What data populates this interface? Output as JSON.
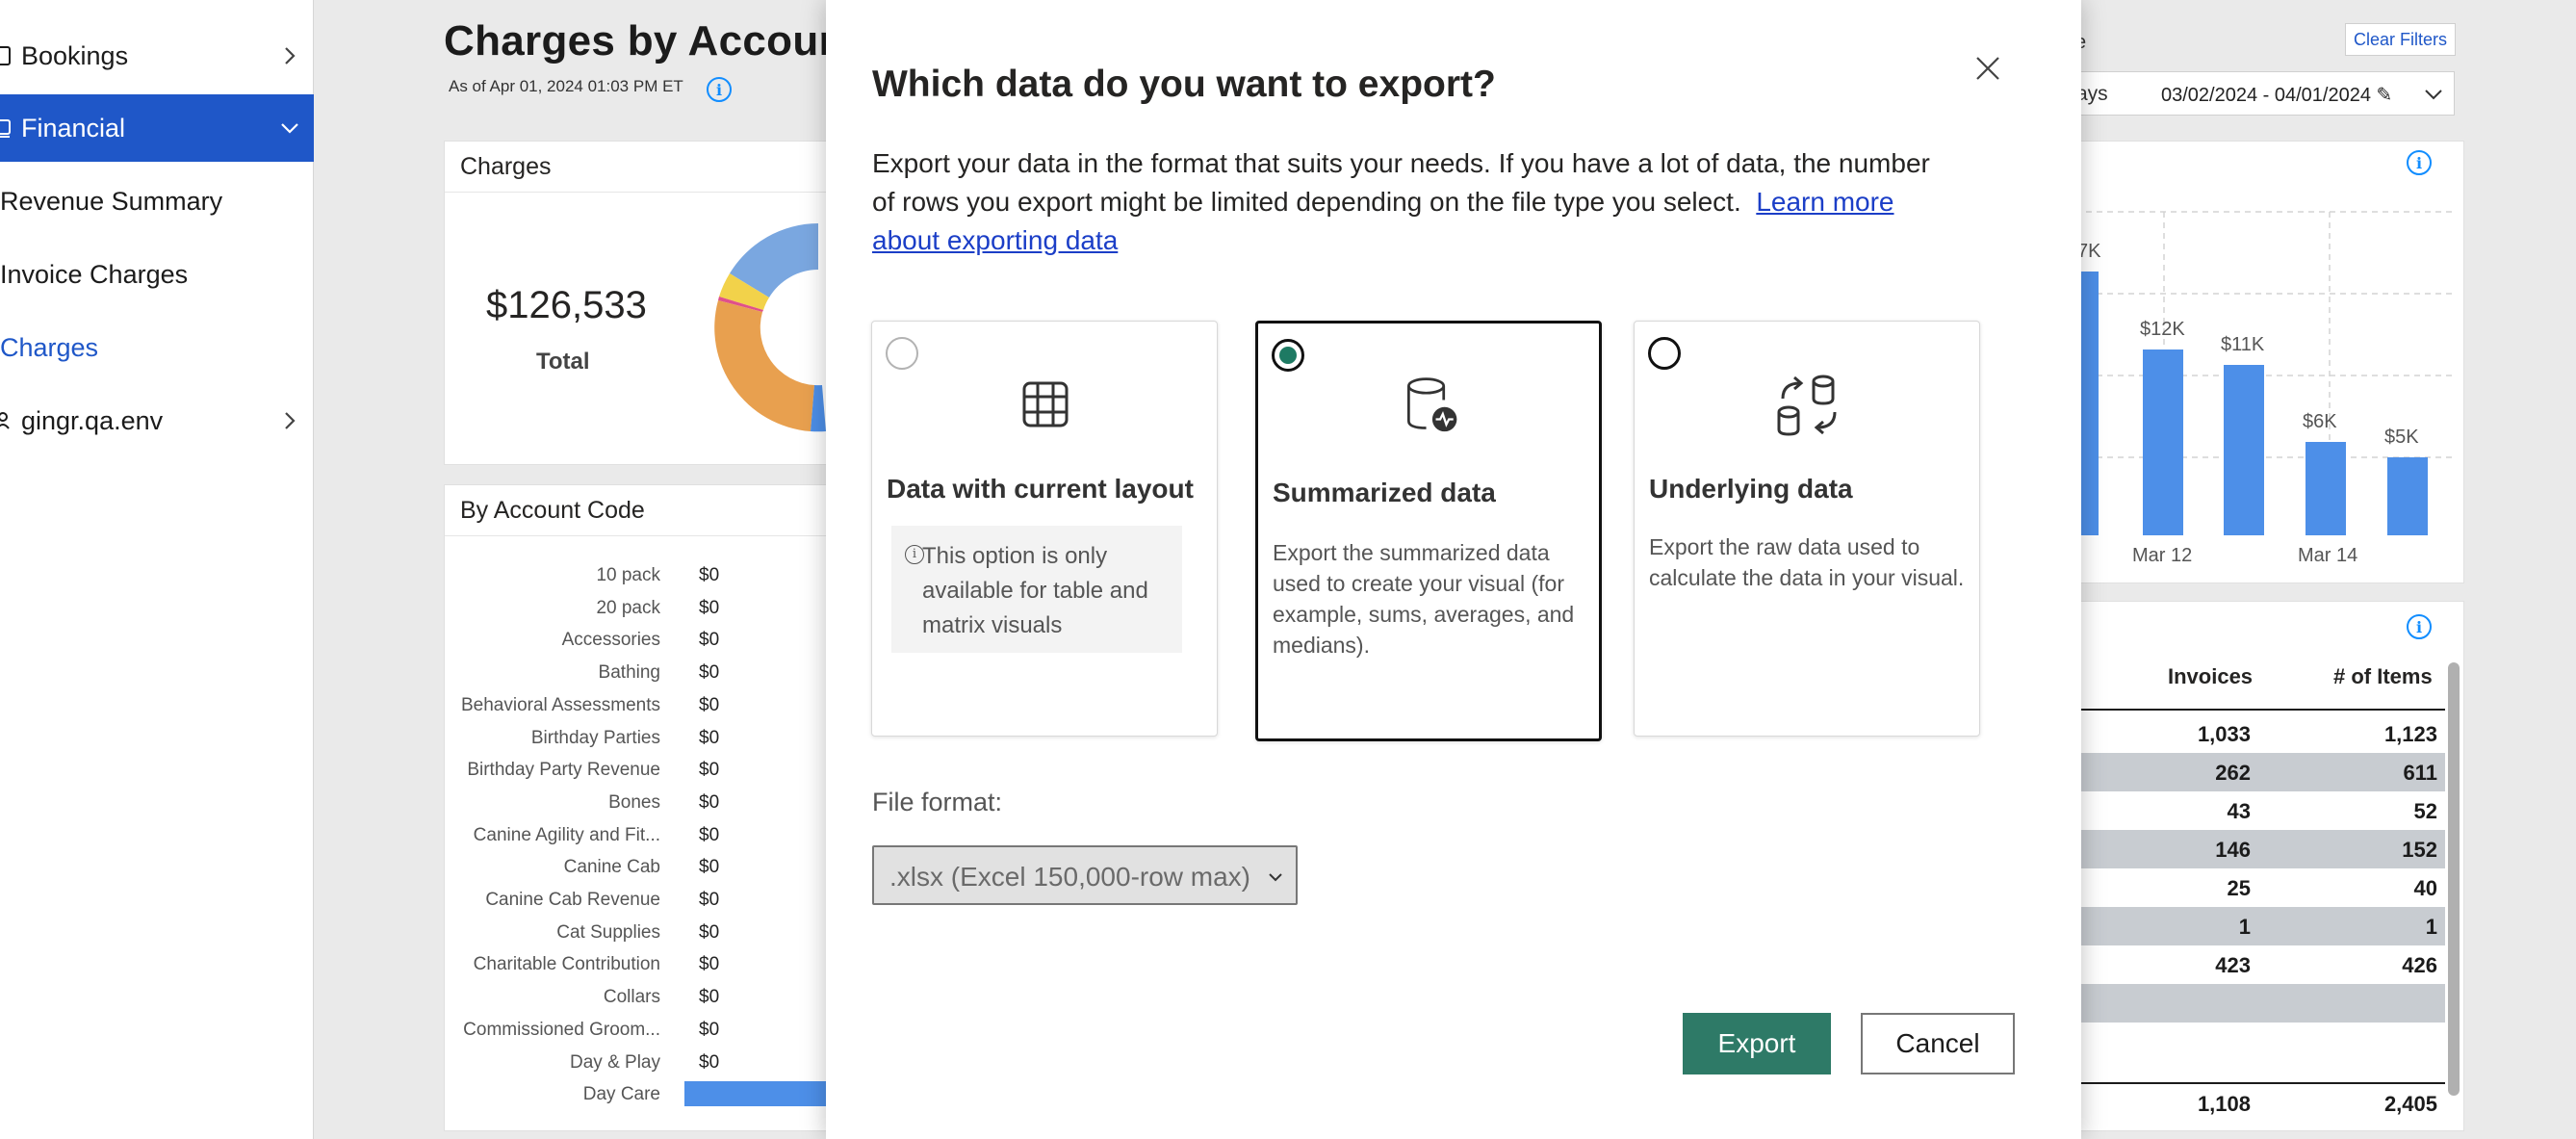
{
  "nav": {
    "items": [
      {
        "label": "Bookings"
      },
      {
        "label": "Financial"
      },
      {
        "label": "Revenue Summary"
      },
      {
        "label": "Invoice Charges"
      },
      {
        "label": "Charges"
      },
      {
        "label": "gingr.qa.env"
      }
    ]
  },
  "report": {
    "title": "Charges by Accoun",
    "as_of": "As of Apr 01, 2024 01:03 PM ET",
    "charges_card": {
      "title": "Charges",
      "total_value": "$126,533",
      "total_label": "Total"
    },
    "account_card": {
      "title": "By Account Code",
      "rows": [
        {
          "name": "10 pack",
          "value": "$0"
        },
        {
          "name": "20 pack",
          "value": "$0"
        },
        {
          "name": "Accessories",
          "value": "$0"
        },
        {
          "name": "Bathing",
          "value": "$0"
        },
        {
          "name": "Behavioral Assessments",
          "value": "$0"
        },
        {
          "name": "Birthday Parties",
          "value": "$0"
        },
        {
          "name": "Birthday Party Revenue",
          "value": "$0"
        },
        {
          "name": "Bones",
          "value": "$0"
        },
        {
          "name": "Canine Agility and Fit...",
          "value": "$0"
        },
        {
          "name": "Canine Cab",
          "value": "$0"
        },
        {
          "name": "Canine Cab Revenue",
          "value": "$0"
        },
        {
          "name": "Cat Supplies",
          "value": "$0"
        },
        {
          "name": "Charitable Contribution",
          "value": "$0"
        },
        {
          "name": "Collars",
          "value": "$0"
        },
        {
          "name": "Commissioned Groom...",
          "value": "$0"
        },
        {
          "name": "Day & Play",
          "value": "$0"
        },
        {
          "name": "Day Care",
          "value": ""
        }
      ]
    },
    "filters": {
      "clear_label": "Clear Filters",
      "label_fragment": "e",
      "days_fragment": "ays",
      "date_range": "03/02/2024 - 04/01/2024 ✎"
    },
    "table": {
      "headers": [
        "Invoices",
        "# of Items"
      ],
      "rows": [
        [
          "1,033",
          "1,123"
        ],
        [
          "262",
          "611"
        ],
        [
          "43",
          "52"
        ],
        [
          "146",
          "152"
        ],
        [
          "25",
          "40"
        ],
        [
          "1",
          "1"
        ],
        [
          "423",
          "426"
        ],
        [
          "",
          ""
        ],
        [
          "",
          ""
        ],
        [
          "",
          ""
        ],
        [
          "1,108",
          "2,405"
        ]
      ]
    }
  },
  "chart_data": {
    "type": "bar",
    "bar_labels": [
      "7K",
      "$12K",
      "$11K",
      "$6K",
      "$5K"
    ],
    "values": [
      17000,
      12000,
      11000,
      6000,
      5000
    ],
    "x_ticks": [
      "Mar 12",
      "Mar 14"
    ],
    "grid": true,
    "color": "#4d8fe8"
  },
  "donut": {
    "colors": [
      "#7aa7e0",
      "#e8a04f",
      "#f2d24a",
      "#e0508a",
      "#4d8fe8"
    ]
  },
  "modal": {
    "title": "Which data do you want to export?",
    "description": "Export your data in the format that suits your needs. If you have a lot of data, the number of rows you export might be limited depending on the file type you select.",
    "learn_more": "Learn more about exporting data",
    "options": [
      {
        "title": "Data with current layout",
        "note": "This option is only available for table and matrix visuals",
        "icon": "table-icon"
      },
      {
        "title": "Summarized data",
        "text": "Export the summarized data used to create your visual (for example, sums, averages, and medians).",
        "icon": "database-activity-icon"
      },
      {
        "title": "Underlying data",
        "text": "Export the raw data used to calculate the data in your visual.",
        "icon": "database-transfer-icon"
      }
    ],
    "file_format_label": "File format:",
    "file_format_value": ".xlsx (Excel 150,000-row max)",
    "export_label": "Export",
    "cancel_label": "Cancel"
  },
  "colors": {
    "nav_active": "#1f57c8",
    "export_button": "#2e7a67",
    "radio_selected": "#1e7a63",
    "link": "#1b3ec7"
  }
}
